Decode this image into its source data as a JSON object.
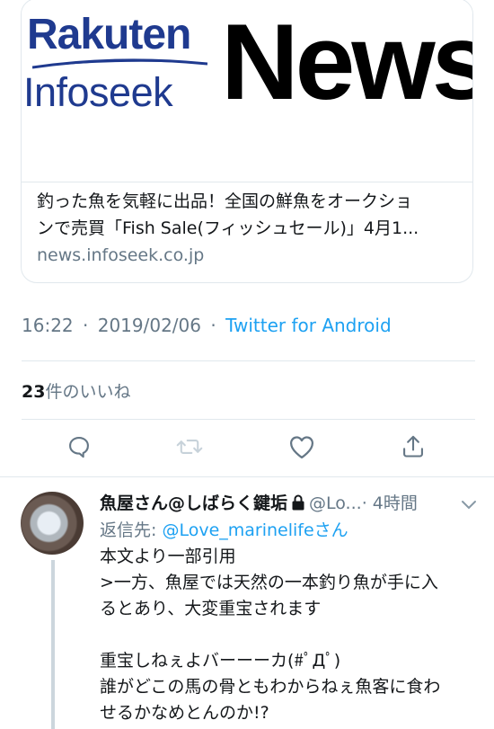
{
  "card": {
    "logo_rakuten": "Rakuten",
    "logo_infoseek": "Infoseek",
    "logo_news": "News",
    "title_line1": "釣った魚を気軽に出品！全国の鮮魚をオークショ",
    "title_line2": "ンで売買「Fish Sale(フィッシュセール)」4月1...",
    "domain": "news.infoseek.co.jp"
  },
  "meta": {
    "time": "16:22",
    "separator": "·",
    "date": "2019/02/06",
    "source": "Twitter for Android"
  },
  "likes": {
    "count": "23",
    "label": "件のいいね"
  },
  "actions": {
    "icons": [
      "reply-icon",
      "retweet-icon",
      "like-icon",
      "share-icon"
    ]
  },
  "reply": {
    "display_name": "魚屋さん@しばらく鍵垢",
    "handle": "@Lo...",
    "time": "· 4時間",
    "reply_to_prefix": "返信先: ",
    "reply_to_mention": "@Love_marinelifeさん",
    "body_lines": [
      "本文より一部引用",
      ">一方、魚屋では天然の一本釣り魚が手に入",
      "るとあり、大変重宝されます",
      "",
      "重宝しねぇよバーーーカ(#ﾟДﾟ)",
      "誰がどこの馬の骨ともわからねぇ魚客に食わ",
      "せるかなめとんのか!?"
    ]
  },
  "colors": {
    "brand_blue": "#1da1f2",
    "muted_gray": "#657786",
    "rakuten_navy": "#1f3a8f"
  }
}
